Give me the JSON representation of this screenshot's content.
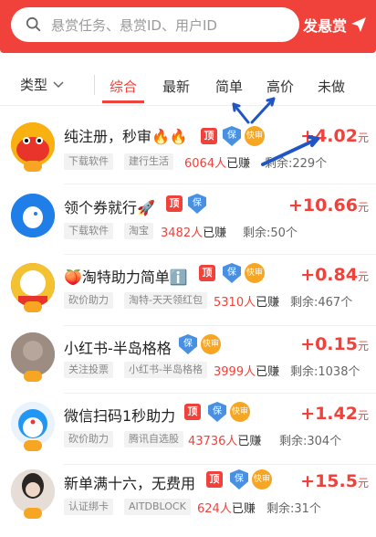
{
  "search": {
    "placeholder": "悬赏任务、悬赏ID、用户ID"
  },
  "header": {
    "publish_label": "发悬赏"
  },
  "filters": {
    "type_label": "类型",
    "tabs": [
      {
        "label": "综合",
        "active": true
      },
      {
        "label": "最新",
        "active": false
      },
      {
        "label": "简单",
        "active": false
      },
      {
        "label": "高价",
        "active": false
      },
      {
        "label": "未做",
        "active": false
      }
    ]
  },
  "badges": {
    "top": "顶",
    "bao": "保",
    "kuai": "快审"
  },
  "tasks": [
    {
      "title": "纯注册，秒审🔥🔥",
      "tags": [
        "下载软件",
        "建行生活"
      ],
      "earned_count": "6064人",
      "earned_suffix": "已赚",
      "remaining": "剩余:229个",
      "reward_value": "+4.02",
      "reward_unit": "元"
    },
    {
      "title": "领个券就行🚀",
      "tags": [
        "下载软件",
        "淘宝"
      ],
      "earned_count": "3482人",
      "earned_suffix": "已赚",
      "remaining": "剩余:50个",
      "reward_value": "+10.66",
      "reward_unit": "元"
    },
    {
      "title": "🍑淘特助力简单ℹ️",
      "tags": [
        "砍价助力",
        "淘特-天天领红包"
      ],
      "earned_count": "5310人",
      "earned_suffix": "已赚",
      "remaining": "剩余:467个",
      "reward_value": "+0.84",
      "reward_unit": "元"
    },
    {
      "title": "小红书-半岛格格",
      "tags": [
        "关注投票",
        "小红书-半岛格格"
      ],
      "earned_count": "3999人",
      "earned_suffix": "已赚",
      "remaining": "剩余:1038个",
      "reward_value": "+0.15",
      "reward_unit": "元"
    },
    {
      "title": "微信扫码1秒助力",
      "tags": [
        "砍价助力",
        "腾讯自选股"
      ],
      "earned_count": "43736人",
      "earned_suffix": "已赚",
      "remaining": "剩余:304个",
      "reward_value": "+1.42",
      "reward_unit": "元"
    },
    {
      "title": "新单满十六，无费用",
      "tags": [
        "认证绑卡",
        "AITDBLOCK"
      ],
      "earned_count": "624人",
      "earned_suffix": "已赚",
      "remaining": "剩余:31个",
      "reward_value": "+15.5",
      "reward_unit": "元"
    }
  ],
  "colors": {
    "brand_red": "#f0413a",
    "annotation_arrow": "#1f56c4",
    "shield_blue": "#4a90e2",
    "badge_orange": "#f6a623"
  }
}
